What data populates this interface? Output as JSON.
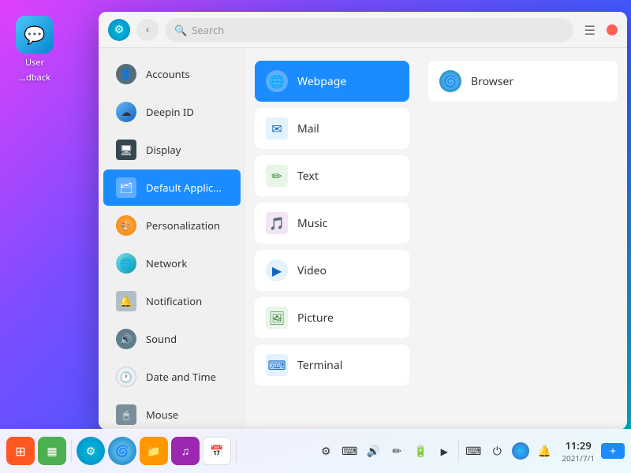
{
  "desktop": {
    "icon": {
      "label1": "User",
      "label2": "...dback"
    }
  },
  "titlebar": {
    "search_placeholder": "Search",
    "menu_icon": "☰",
    "back_icon": "‹"
  },
  "sidebar": {
    "items": [
      {
        "id": "accounts",
        "label": "Accounts",
        "icon": "👤"
      },
      {
        "id": "deepin-id",
        "label": "Deepin ID",
        "icon": "☁"
      },
      {
        "id": "display",
        "label": "Display",
        "icon": "🖥"
      },
      {
        "id": "default-apps",
        "label": "Default Applic...",
        "icon": "🗂",
        "active": true
      },
      {
        "id": "personalization",
        "label": "Personalization",
        "icon": "🎨"
      },
      {
        "id": "network",
        "label": "Network",
        "icon": "🌐"
      },
      {
        "id": "notification",
        "label": "Notification",
        "icon": "🔔"
      },
      {
        "id": "sound",
        "label": "Sound",
        "icon": "🔊"
      },
      {
        "id": "date-time",
        "label": "Date and Time",
        "icon": "🕐"
      },
      {
        "id": "mouse",
        "label": "Mouse",
        "icon": "🖱"
      }
    ]
  },
  "apps": [
    {
      "id": "webpage",
      "label": "Webpage",
      "icon": "🌐",
      "selected": true
    },
    {
      "id": "mail",
      "label": "Mail",
      "icon": "✉"
    },
    {
      "id": "text",
      "label": "Text",
      "icon": "✏"
    },
    {
      "id": "music",
      "label": "Music",
      "icon": "🎵"
    },
    {
      "id": "video",
      "label": "Video",
      "icon": "▶"
    },
    {
      "id": "picture",
      "label": "Picture",
      "icon": "🖼"
    },
    {
      "id": "terminal",
      "label": "Terminal",
      "icon": "⌨"
    }
  ],
  "right_panel": [
    {
      "id": "browser",
      "label": "Browser",
      "icon": "🌐"
    }
  ],
  "taskbar": {
    "time": "11:29",
    "date": "2021/7/1",
    "icons": [
      {
        "id": "launcher",
        "icon": "⊞",
        "color": "#ff5722"
      },
      {
        "id": "multitasking",
        "icon": "▦",
        "color": "#4caf50"
      },
      {
        "id": "settings-tray",
        "icon": "⚙",
        "color": "#2196f3"
      },
      {
        "id": "browser-tray",
        "icon": "🌀",
        "color": "#03a9f4"
      },
      {
        "id": "files",
        "icon": "📁",
        "color": "#ff9800"
      },
      {
        "id": "music-tray",
        "icon": "♫",
        "color": "#9c27b0"
      },
      {
        "id": "calendar",
        "icon": "📅",
        "color": "#f44336"
      }
    ],
    "tray": [
      {
        "id": "settings2",
        "icon": "⚙"
      },
      {
        "id": "keyboard",
        "icon": "⌨"
      },
      {
        "id": "volume",
        "icon": "🔊"
      },
      {
        "id": "pen",
        "icon": "✏"
      },
      {
        "id": "battery",
        "icon": "🔋"
      },
      {
        "id": "arrow",
        "icon": "▶"
      },
      {
        "id": "kb2",
        "icon": "⌨"
      },
      {
        "id": "power",
        "icon": "⏻"
      },
      {
        "id": "earth",
        "icon": "🌐"
      },
      {
        "id": "bell",
        "icon": "🔔"
      }
    ]
  }
}
